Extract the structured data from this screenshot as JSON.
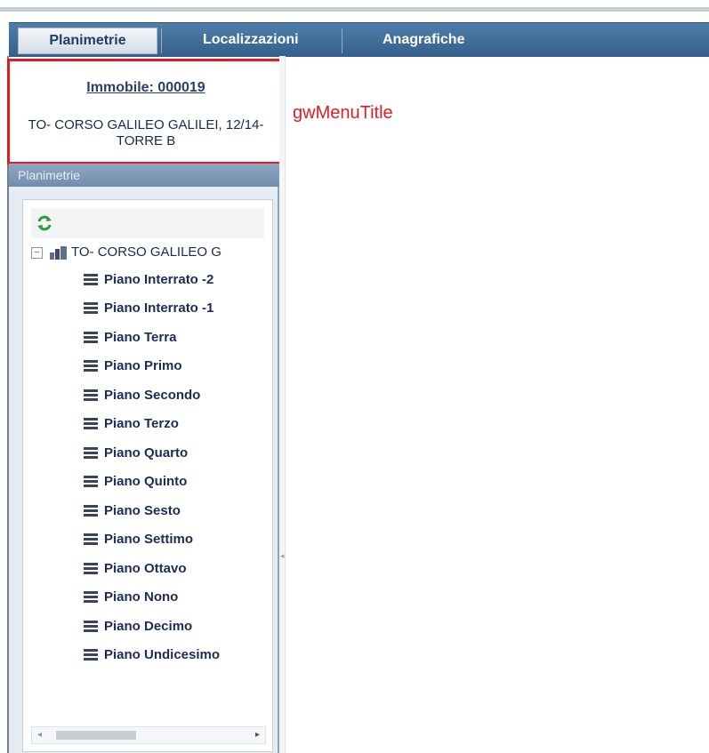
{
  "tabs": [
    {
      "label": "Planimetrie",
      "active": true
    },
    {
      "label": "Localizzazioni",
      "active": false
    },
    {
      "label": "Anagrafiche",
      "active": false
    }
  ],
  "title_box": {
    "link": "Immobile: 000019",
    "address": "TO- CORSO GALILEO GALILEI, 12/14- TORRE B"
  },
  "annotation": "gwMenuTitle",
  "panel": {
    "header": "Planimetrie",
    "root_label": "TO- CORSO GALILEO G",
    "floors": [
      "Piano Interrato -2",
      "Piano Interrato -1",
      "Piano Terra",
      "Piano Primo",
      "Piano Secondo",
      "Piano Terzo",
      "Piano Quarto",
      "Piano Quinto",
      "Piano Sesto",
      "Piano Settimo",
      "Piano Ottavo",
      "Piano Nono",
      "Piano Decimo",
      "Piano Undicesimo"
    ]
  },
  "colors": {
    "accent": "#e31b23",
    "tabbar": "#3f6a96",
    "link": "#2a3f6b"
  },
  "icons": {
    "refresh": "refresh-icon",
    "building": "building-icon",
    "floor": "layers-icon",
    "expander": "collapse-icon"
  }
}
